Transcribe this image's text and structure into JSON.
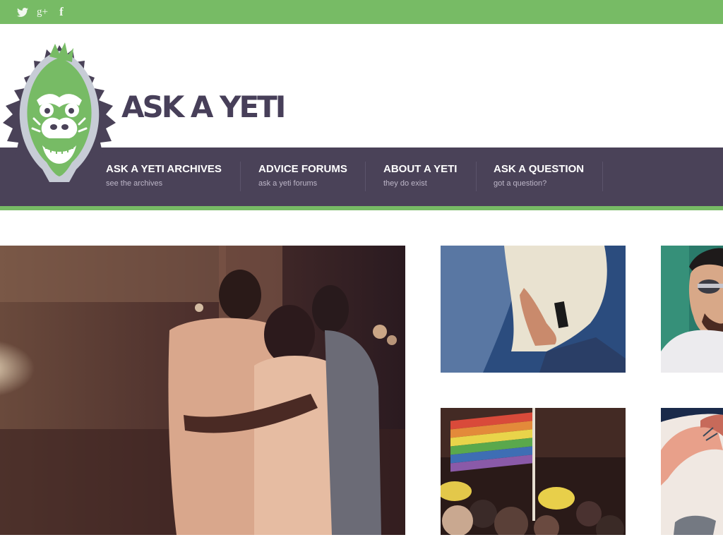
{
  "social": [
    {
      "name": "twitter-icon"
    },
    {
      "name": "googleplus-icon",
      "glyph": "g+"
    },
    {
      "name": "facebook-icon",
      "glyph": "f"
    }
  ],
  "site": {
    "title": "ASK A YETI"
  },
  "nav": [
    {
      "label": "ASK A YETI ARCHIVES",
      "sub": "see the archives"
    },
    {
      "label": "ADVICE FORUMS",
      "sub": "ask a yeti forums"
    },
    {
      "label": "ABOUT A YETI",
      "sub": "they do exist"
    },
    {
      "label": "ASK A QUESTION",
      "sub": "got a question?"
    }
  ],
  "colors": {
    "topbar": "#77bb65",
    "navbar": "#4a4258",
    "title": "#473f59",
    "accent": "#77bb65"
  }
}
